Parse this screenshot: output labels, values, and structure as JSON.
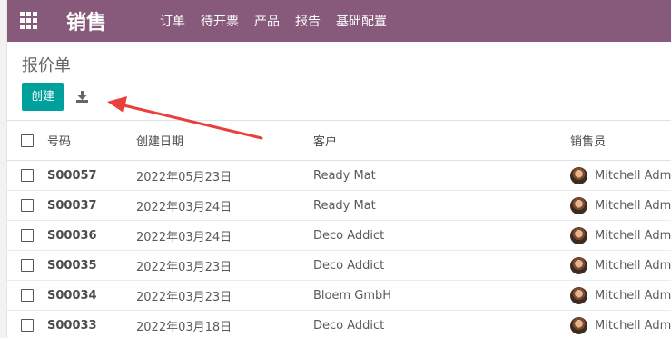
{
  "app": {
    "brand": "销售",
    "menu": [
      "订单",
      "待开票",
      "产品",
      "报告",
      "基础配置"
    ]
  },
  "page": {
    "title": "报价单",
    "create_label": "创建"
  },
  "table": {
    "headers": {
      "number": "号码",
      "date": "创建日期",
      "customer": "客户",
      "salesperson": "销售员"
    },
    "rows": [
      {
        "number": "S00057",
        "date": "2022年05月23日",
        "customer": "Ready Mat",
        "salesperson": "Mitchell Admin"
      },
      {
        "number": "S00037",
        "date": "2022年03月24日",
        "customer": "Ready Mat",
        "salesperson": "Mitchell Admin"
      },
      {
        "number": "S00036",
        "date": "2022年03月24日",
        "customer": "Deco Addict",
        "salesperson": "Mitchell Admin"
      },
      {
        "number": "S00035",
        "date": "2022年03月23日",
        "customer": "Deco Addict",
        "salesperson": "Mitchell Admin"
      },
      {
        "number": "S00034",
        "date": "2022年03月23日",
        "customer": "Bloem GmbH",
        "salesperson": "Mitchell Admin"
      },
      {
        "number": "S00033",
        "date": "2022年03月18日",
        "customer": "Deco Addict",
        "salesperson": "Mitchell Admin"
      }
    ]
  },
  "colors": {
    "navbar": "#875a7b",
    "primary_button": "#00a09d",
    "annotation_arrow": "#e8403a"
  }
}
